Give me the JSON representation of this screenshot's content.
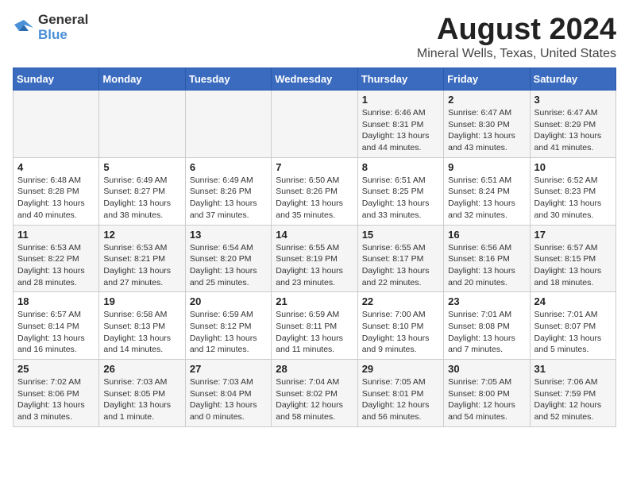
{
  "header": {
    "logo_line1": "General",
    "logo_line2": "Blue",
    "main_title": "August 2024",
    "subtitle": "Mineral Wells, Texas, United States"
  },
  "days_of_week": [
    "Sunday",
    "Monday",
    "Tuesday",
    "Wednesday",
    "Thursday",
    "Friday",
    "Saturday"
  ],
  "weeks": [
    [
      {
        "day": "",
        "info": ""
      },
      {
        "day": "",
        "info": ""
      },
      {
        "day": "",
        "info": ""
      },
      {
        "day": "",
        "info": ""
      },
      {
        "day": "1",
        "info": "Sunrise: 6:46 AM\nSunset: 8:31 PM\nDaylight: 13 hours\nand 44 minutes."
      },
      {
        "day": "2",
        "info": "Sunrise: 6:47 AM\nSunset: 8:30 PM\nDaylight: 13 hours\nand 43 minutes."
      },
      {
        "day": "3",
        "info": "Sunrise: 6:47 AM\nSunset: 8:29 PM\nDaylight: 13 hours\nand 41 minutes."
      }
    ],
    [
      {
        "day": "4",
        "info": "Sunrise: 6:48 AM\nSunset: 8:28 PM\nDaylight: 13 hours\nand 40 minutes."
      },
      {
        "day": "5",
        "info": "Sunrise: 6:49 AM\nSunset: 8:27 PM\nDaylight: 13 hours\nand 38 minutes."
      },
      {
        "day": "6",
        "info": "Sunrise: 6:49 AM\nSunset: 8:26 PM\nDaylight: 13 hours\nand 37 minutes."
      },
      {
        "day": "7",
        "info": "Sunrise: 6:50 AM\nSunset: 8:26 PM\nDaylight: 13 hours\nand 35 minutes."
      },
      {
        "day": "8",
        "info": "Sunrise: 6:51 AM\nSunset: 8:25 PM\nDaylight: 13 hours\nand 33 minutes."
      },
      {
        "day": "9",
        "info": "Sunrise: 6:51 AM\nSunset: 8:24 PM\nDaylight: 13 hours\nand 32 minutes."
      },
      {
        "day": "10",
        "info": "Sunrise: 6:52 AM\nSunset: 8:23 PM\nDaylight: 13 hours\nand 30 minutes."
      }
    ],
    [
      {
        "day": "11",
        "info": "Sunrise: 6:53 AM\nSunset: 8:22 PM\nDaylight: 13 hours\nand 28 minutes."
      },
      {
        "day": "12",
        "info": "Sunrise: 6:53 AM\nSunset: 8:21 PM\nDaylight: 13 hours\nand 27 minutes."
      },
      {
        "day": "13",
        "info": "Sunrise: 6:54 AM\nSunset: 8:20 PM\nDaylight: 13 hours\nand 25 minutes."
      },
      {
        "day": "14",
        "info": "Sunrise: 6:55 AM\nSunset: 8:19 PM\nDaylight: 13 hours\nand 23 minutes."
      },
      {
        "day": "15",
        "info": "Sunrise: 6:55 AM\nSunset: 8:17 PM\nDaylight: 13 hours\nand 22 minutes."
      },
      {
        "day": "16",
        "info": "Sunrise: 6:56 AM\nSunset: 8:16 PM\nDaylight: 13 hours\nand 20 minutes."
      },
      {
        "day": "17",
        "info": "Sunrise: 6:57 AM\nSunset: 8:15 PM\nDaylight: 13 hours\nand 18 minutes."
      }
    ],
    [
      {
        "day": "18",
        "info": "Sunrise: 6:57 AM\nSunset: 8:14 PM\nDaylight: 13 hours\nand 16 minutes."
      },
      {
        "day": "19",
        "info": "Sunrise: 6:58 AM\nSunset: 8:13 PM\nDaylight: 13 hours\nand 14 minutes."
      },
      {
        "day": "20",
        "info": "Sunrise: 6:59 AM\nSunset: 8:12 PM\nDaylight: 13 hours\nand 12 minutes."
      },
      {
        "day": "21",
        "info": "Sunrise: 6:59 AM\nSunset: 8:11 PM\nDaylight: 13 hours\nand 11 minutes."
      },
      {
        "day": "22",
        "info": "Sunrise: 7:00 AM\nSunset: 8:10 PM\nDaylight: 13 hours\nand 9 minutes."
      },
      {
        "day": "23",
        "info": "Sunrise: 7:01 AM\nSunset: 8:08 PM\nDaylight: 13 hours\nand 7 minutes."
      },
      {
        "day": "24",
        "info": "Sunrise: 7:01 AM\nSunset: 8:07 PM\nDaylight: 13 hours\nand 5 minutes."
      }
    ],
    [
      {
        "day": "25",
        "info": "Sunrise: 7:02 AM\nSunset: 8:06 PM\nDaylight: 13 hours\nand 3 minutes."
      },
      {
        "day": "26",
        "info": "Sunrise: 7:03 AM\nSunset: 8:05 PM\nDaylight: 13 hours\nand 1 minute."
      },
      {
        "day": "27",
        "info": "Sunrise: 7:03 AM\nSunset: 8:04 PM\nDaylight: 13 hours\nand 0 minutes."
      },
      {
        "day": "28",
        "info": "Sunrise: 7:04 AM\nSunset: 8:02 PM\nDaylight: 12 hours\nand 58 minutes."
      },
      {
        "day": "29",
        "info": "Sunrise: 7:05 AM\nSunset: 8:01 PM\nDaylight: 12 hours\nand 56 minutes."
      },
      {
        "day": "30",
        "info": "Sunrise: 7:05 AM\nSunset: 8:00 PM\nDaylight: 12 hours\nand 54 minutes."
      },
      {
        "day": "31",
        "info": "Sunrise: 7:06 AM\nSunset: 7:59 PM\nDaylight: 12 hours\nand 52 minutes."
      }
    ]
  ]
}
